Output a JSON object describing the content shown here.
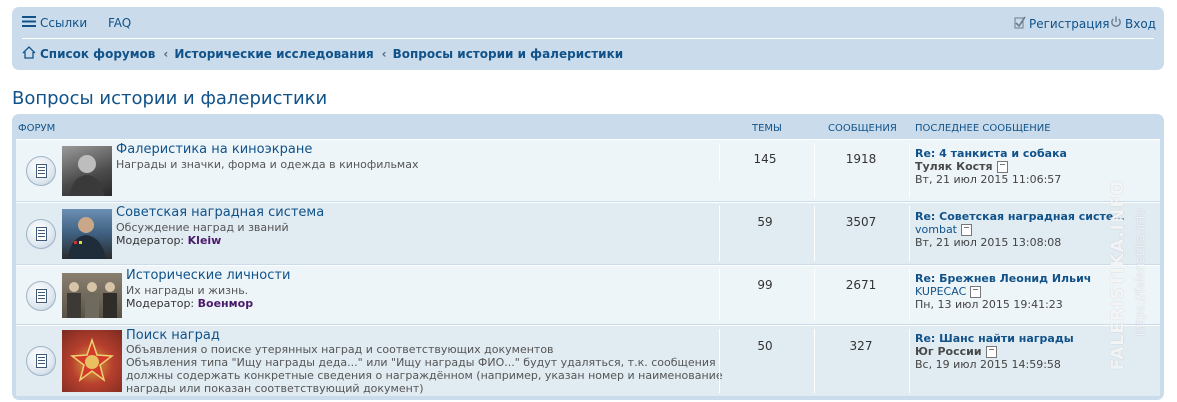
{
  "nav": {
    "links_label": "Ссылки",
    "faq_label": "FAQ",
    "register_label": "Регистрация",
    "login_label": "Вход"
  },
  "breadcrumbs": [
    "Список форумов",
    "Исторические исследования",
    "Вопросы истории и фалеристики"
  ],
  "page_title": "Вопросы истории и фалеристики",
  "table": {
    "headers": {
      "forum": "ФОРУМ",
      "topics": "ТЕМЫ",
      "posts": "СООБЩЕНИЯ",
      "last_post": "ПОСЛЕДНЕЕ СООБЩЕНИЕ"
    },
    "rows": [
      {
        "name": "Фалеристика на киноэкране",
        "desc": [
          "Награды и значки, форма и одежда в кинофильмах"
        ],
        "moderator_label": "",
        "moderator": "",
        "topics": "145",
        "posts": "1918",
        "last_title": "Re: 4 танкиста и собака",
        "last_author": "Туляк Костя",
        "last_date": "Вт, 21 июл 2015 11:06:57"
      },
      {
        "name": "Советская наградная система",
        "desc": [
          "Обсуждение наград и званий"
        ],
        "moderator_label": "Модератор:",
        "moderator": "Kleiw",
        "topics": "59",
        "posts": "3507",
        "last_title": "Re: Советская наградная систе…",
        "last_author": "vombat",
        "last_date": "Вт, 21 июл 2015 13:08:08"
      },
      {
        "name": "Исторические личности",
        "desc": [
          "Их награды и жизнь."
        ],
        "moderator_label": "Модератор:",
        "moderator": "Военмор",
        "topics": "99",
        "posts": "2671",
        "last_title": "Re: Брежнев Леонид Ильич",
        "last_author": "KUPECAC",
        "last_date": "Пн, 13 июл 2015 19:41:23"
      },
      {
        "name": "Поиск наград",
        "desc": [
          "Объявления о поиске утерянных наград и соответствующих документов",
          "Объявления типа \"Ищу награды деда...\" или \"Ищу награды ФИО...\" будут удаляться, т.к. сообщения",
          "должны содержать конкретные сведения о награждённом (например, указан номер и наименование",
          "награды или показан соответствующий документ)"
        ],
        "moderator_label": "",
        "moderator": "",
        "topics": "50",
        "posts": "327",
        "last_title": "Re: Шанс найти награды",
        "last_author": "Юг России",
        "last_date": "Вс, 19 июл 2015 14:59:58"
      }
    ]
  },
  "watermark": {
    "line1": "FALERISTIKA.INFO",
    "line2": "https://faleristika.info"
  },
  "colors": {
    "link": "#105289",
    "nav_bg": "#cadceb",
    "row_light": "#eef5f9",
    "row_dark": "#e1ebf2"
  }
}
